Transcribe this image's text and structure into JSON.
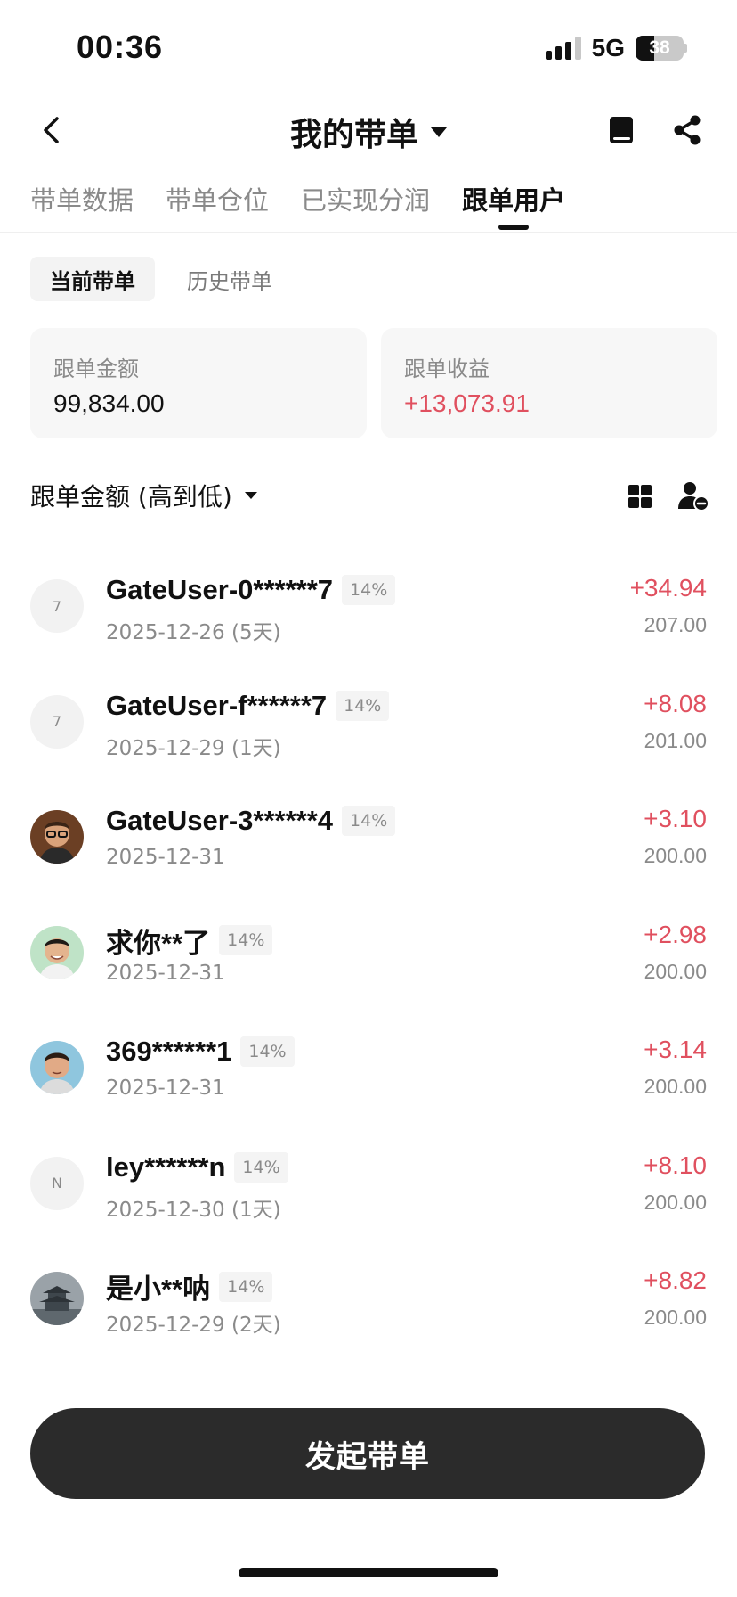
{
  "status_bar": {
    "time": "00:36",
    "network": "5G",
    "battery": "38",
    "battery_level": 0.38
  },
  "nav": {
    "title": "我的带单",
    "icons": [
      "back-icon",
      "book-icon",
      "share-icon"
    ]
  },
  "tabs": [
    {
      "label": "带单数据",
      "active": false
    },
    {
      "label": "带单仓位",
      "active": false
    },
    {
      "label": "已实现分润",
      "active": false
    },
    {
      "label": "跟单用户",
      "active": true
    }
  ],
  "subtabs": [
    {
      "label": "当前带单",
      "active": true
    },
    {
      "label": "历史带单",
      "active": false
    }
  ],
  "summary": {
    "amount_label": "跟单金额",
    "amount_value": "99,834.00",
    "profit_label": "跟单收益",
    "profit_value": "+13,073.91"
  },
  "sort": {
    "label": "跟单金额 (高到低)",
    "icons": [
      "grid-icon",
      "user-remove-icon"
    ]
  },
  "followers": [
    {
      "avatar": "7",
      "name": "GateUser-0******7",
      "pct": "14%",
      "date": "2025-12-26 (5天)",
      "profit": "+34.94",
      "amount": "207.00"
    },
    {
      "avatar": "7",
      "name": "GateUser-f******7",
      "pct": "14%",
      "date": "2025-12-29 (1天)",
      "profit": "+8.08",
      "amount": "201.00"
    },
    {
      "avatar": "",
      "name": "GateUser-3******4",
      "pct": "14%",
      "date": "2025-12-31",
      "profit": "+3.10",
      "amount": "200.00"
    },
    {
      "avatar": "",
      "name": "求你**了",
      "pct": "14%",
      "date": "2025-12-31",
      "profit": "+2.98",
      "amount": "200.00"
    },
    {
      "avatar": "",
      "name": "369******1",
      "pct": "14%",
      "date": "2025-12-31",
      "profit": "+3.14",
      "amount": "200.00"
    },
    {
      "avatar": "N",
      "name": "ley******n",
      "pct": "14%",
      "date": "2025-12-30 (1天)",
      "profit": "+8.10",
      "amount": "200.00"
    },
    {
      "avatar": "",
      "name": "是小**呐",
      "pct": "14%",
      "date": "2025-12-29 (2天)",
      "profit": "+8.82",
      "amount": "200.00"
    }
  ],
  "cta": {
    "label": "发起带单"
  },
  "colors": {
    "positive": "#e0505f",
    "muted": "#8a8a8a",
    "cta_bg": "#2b2b2b"
  }
}
